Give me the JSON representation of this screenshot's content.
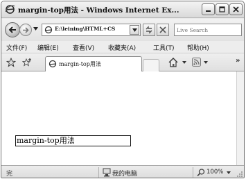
{
  "window": {
    "title": "margin-top用法 - Windows Internet Ex..."
  },
  "address_bar": {
    "url": "E:\\leining\\HTML+CS",
    "search_placeholder": "Live Search"
  },
  "menu": {
    "items": [
      "文件(F)",
      "编辑(E)",
      "查看(V)",
      "收藏夹(A)",
      "工具(T)",
      "帮助(H)"
    ]
  },
  "tab": {
    "label": "margin-top用法"
  },
  "page": {
    "demo_text": "margin-top用法"
  },
  "status": {
    "left_text": "完",
    "zone": "我的电脑",
    "zoom": "100%"
  },
  "colors": {
    "window_frame": "#6f6f6f",
    "chrome_bg": "#e9e9e9",
    "content_bg": "#ffffff"
  }
}
